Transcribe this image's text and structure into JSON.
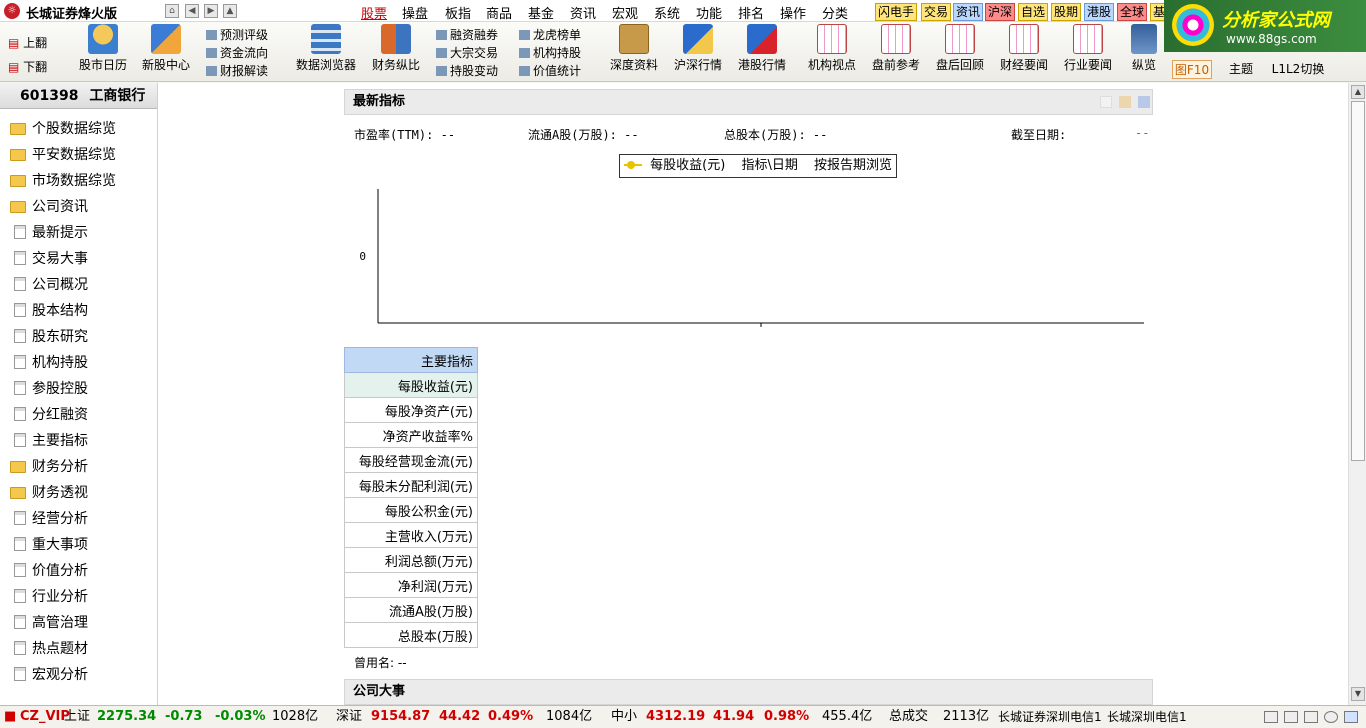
{
  "app": {
    "title": "长城证券烽火版"
  },
  "menu": [
    {
      "label": "股票",
      "active": true
    },
    {
      "label": "操盘"
    },
    {
      "label": "板指"
    },
    {
      "label": "商品"
    },
    {
      "label": "基金"
    },
    {
      "label": "资讯"
    },
    {
      "label": "宏观"
    },
    {
      "label": "系统"
    },
    {
      "label": "功能"
    },
    {
      "label": "排名"
    },
    {
      "label": "操作"
    },
    {
      "label": "分类"
    }
  ],
  "quick_buttons": [
    "闪电手",
    "交易",
    "资讯",
    "沪深",
    "自选",
    "股期",
    "港股",
    "全球",
    "基"
  ],
  "brand": {
    "name": "分析家公式网",
    "url": "www.88gs.com"
  },
  "toolbar": {
    "page_up": "上翻",
    "page_down": "下翻",
    "tools": [
      {
        "label": "股市日历",
        "icon": "calendar-icon"
      },
      {
        "label": "新股中心",
        "icon": "new-stock-icon"
      },
      {
        "label": "数据浏览器",
        "icon": "data-browser-icon"
      },
      {
        "label": "财务纵比",
        "icon": "finance-compare-icon"
      },
      {
        "label": "深度资料",
        "icon": "deep-data-icon"
      },
      {
        "label": "沪深行情",
        "icon": "sh-sz-quote-icon"
      },
      {
        "label": "港股行情",
        "icon": "hk-quote-icon"
      },
      {
        "label": "机构视点",
        "icon": "chart-icon"
      },
      {
        "label": "盘前参考",
        "icon": "chart-icon"
      },
      {
        "label": "盘后回顾",
        "icon": "chart-icon"
      },
      {
        "label": "财经要闻",
        "icon": "chart-icon"
      },
      {
        "label": "行业要闻",
        "icon": "chart-icon"
      },
      {
        "label": "纵览",
        "icon": "overview-icon"
      },
      {
        "label": "图F10",
        "icon": ""
      },
      {
        "label": "主题",
        "icon": ""
      },
      {
        "label": "L1L2切换",
        "icon": ""
      }
    ],
    "small_links": {
      "col1": [
        "预测评级",
        "资金流向",
        "财报解读"
      ],
      "col2": [
        "融资融券",
        "大宗交易",
        "持股变动"
      ],
      "col3": [
        "龙虎榜单",
        "机构持股",
        "价值统计"
      ]
    }
  },
  "stock": {
    "code": "601398",
    "name": "工商银行"
  },
  "sidebar": [
    {
      "label": "个股数据综览",
      "type": "folder"
    },
    {
      "label": "平安数据综览",
      "type": "folder"
    },
    {
      "label": "市场数据综览",
      "type": "folder"
    },
    {
      "label": "公司资讯",
      "type": "folder"
    },
    {
      "label": "最新提示",
      "type": "doc"
    },
    {
      "label": "交易大事",
      "type": "doc"
    },
    {
      "label": "公司概况",
      "type": "doc"
    },
    {
      "label": "股本结构",
      "type": "doc"
    },
    {
      "label": "股东研究",
      "type": "doc"
    },
    {
      "label": "机构持股",
      "type": "doc"
    },
    {
      "label": "参股控股",
      "type": "doc"
    },
    {
      "label": "分红融资",
      "type": "doc"
    },
    {
      "label": "主要指标",
      "type": "doc"
    },
    {
      "label": "财务分析",
      "type": "folder"
    },
    {
      "label": "财务透视",
      "type": "folder"
    },
    {
      "label": "经营分析",
      "type": "doc"
    },
    {
      "label": "重大事项",
      "type": "doc"
    },
    {
      "label": "价值分析",
      "type": "doc"
    },
    {
      "label": "行业分析",
      "type": "doc"
    },
    {
      "label": "高管治理",
      "type": "doc"
    },
    {
      "label": "热点题材",
      "type": "doc"
    },
    {
      "label": "宏观分析",
      "type": "doc"
    }
  ],
  "metrics_panel": {
    "title": "最新指标",
    "pe_label": "市盈率(TTM):",
    "pe_value": "--",
    "float_a_label": "流通A股(万股):",
    "float_a_value": "--",
    "total_shares_label": "总股本(万股):",
    "total_shares_value": "--",
    "as_of_label": "截至日期:",
    "as_of_value": "--"
  },
  "chart_data": {
    "type": "line",
    "legend": "每股收益(元)",
    "legend_extra": [
      "指标\\日期",
      "按报告期浏览"
    ],
    "y_ticks": [
      0
    ],
    "x": [],
    "series": [
      {
        "name": "每股收益(元)",
        "values": []
      }
    ],
    "series_color": "#e8c400"
  },
  "table": {
    "header": "主要指标",
    "rows": [
      "每股收益(元)",
      "每股净资产(元)",
      "净资产收益率%",
      "每股经营现金流(元)",
      "每股未分配利润(元)",
      "每股公积金(元)",
      "主营收入(万元)",
      "利润总额(万元)",
      "净利润(万元)",
      "流通A股(万股)",
      "总股本(万股)"
    ]
  },
  "former_name": {
    "label": "曾用名:",
    "value": "--"
  },
  "company_events": {
    "title": "公司大事"
  },
  "status": {
    "vip": "CZ_VIP",
    "sh_label": "上证",
    "sh_index": "2275.34",
    "sh_change": "-0.73",
    "sh_pct": "-0.03%",
    "sh_volume": "1028亿",
    "sz_label": "深证",
    "sz_index": "9154.87",
    "sz_change": "44.42",
    "sz_pct": "0.49%",
    "sz_volume": "1084亿",
    "sme_label": "中小",
    "sme_index": "4312.19",
    "sme_change": "41.94",
    "sme_pct": "0.98%",
    "sme_volume": "455.4亿",
    "total_label": "总成交",
    "total_volume": "2113亿",
    "server1": "长城证券深圳电信1",
    "server2": "长城深圳电信1"
  }
}
